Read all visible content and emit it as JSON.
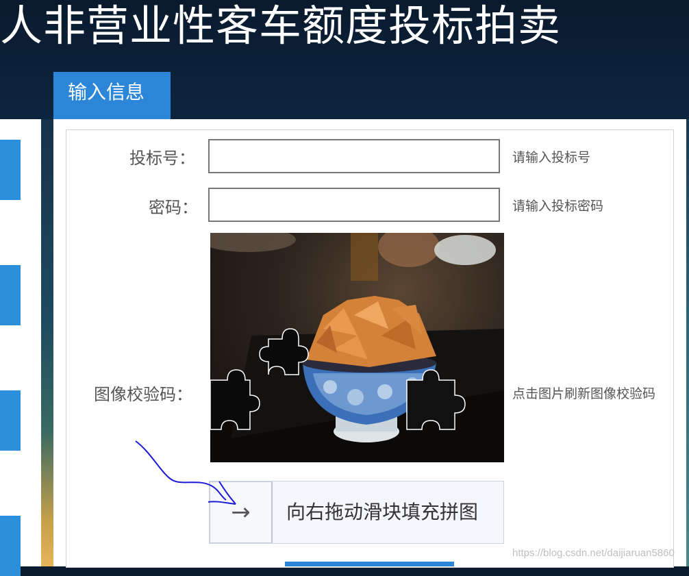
{
  "page": {
    "title": "人非营业性客车额度投标拍卖"
  },
  "tab": {
    "label": "输入信息"
  },
  "form": {
    "bid_number": {
      "label": "投标号：",
      "value": "",
      "placeholder": "",
      "hint": "请输入投标号"
    },
    "password": {
      "label": "密码：",
      "value": "",
      "placeholder": "",
      "hint": "请输入投标密码"
    },
    "captcha": {
      "label": "图像校验码：",
      "hint": "点击图片刷新图像校验码"
    },
    "slider": {
      "label": "向右拖动滑块填充拼图",
      "arrow": "→"
    }
  },
  "watermark": "https://blog.csdn.net/daijiaruan5860",
  "colors": {
    "accent": "#2b86d8",
    "label_text": "#555555",
    "annotation": "#1a1ad8"
  }
}
